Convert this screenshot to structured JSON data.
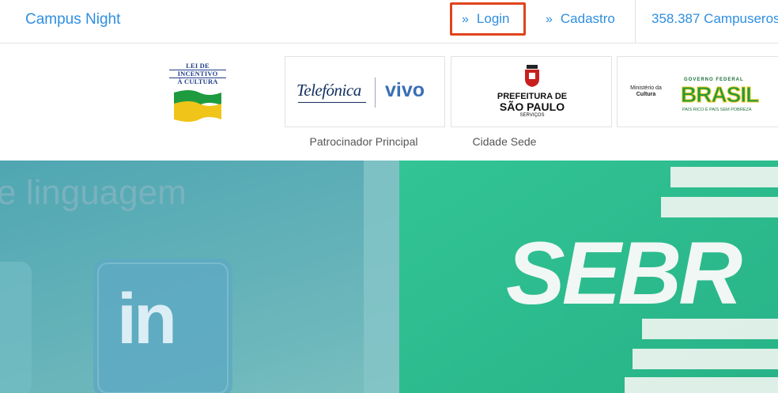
{
  "header": {
    "brand": "Campus Night",
    "login_label": "Login",
    "signup_label": "Cadastro",
    "campuseros_count": "358.387 Campuseros",
    "chevron_glyph": "»"
  },
  "sponsors": {
    "lei_logo_lines": [
      "LEI DE",
      "INCENTIVO",
      "À CULTURA"
    ],
    "telefonica": "Telefónica",
    "vivo": "vivo",
    "prefeitura_lines": [
      "PREFEITURA DE",
      "SÃO PAULO",
      "SERVIÇOS"
    ],
    "ministerio_lines": [
      "Ministério da",
      "Cultura"
    ],
    "governo_federal": "GOVERNO FEDERAL",
    "brasil": "BRASIL",
    "brasil_tagline": "PAÍS RICO É PAÍS SEM POBREZA",
    "caption_main": "Patrocinador Principal",
    "caption_city": "Cidade Sede"
  },
  "hero": {
    "background_text": "e linguagem",
    "linkedin": "in",
    "sebrae_text": "SEBR"
  },
  "colors": {
    "link": "#2f8fe0",
    "highlight": "#e0441c",
    "vivo": "#3b6fb6",
    "brasil_green": "#1e9b3f",
    "brasil_yellow": "#f0c419",
    "sebrae_green": "#2cc08f"
  }
}
